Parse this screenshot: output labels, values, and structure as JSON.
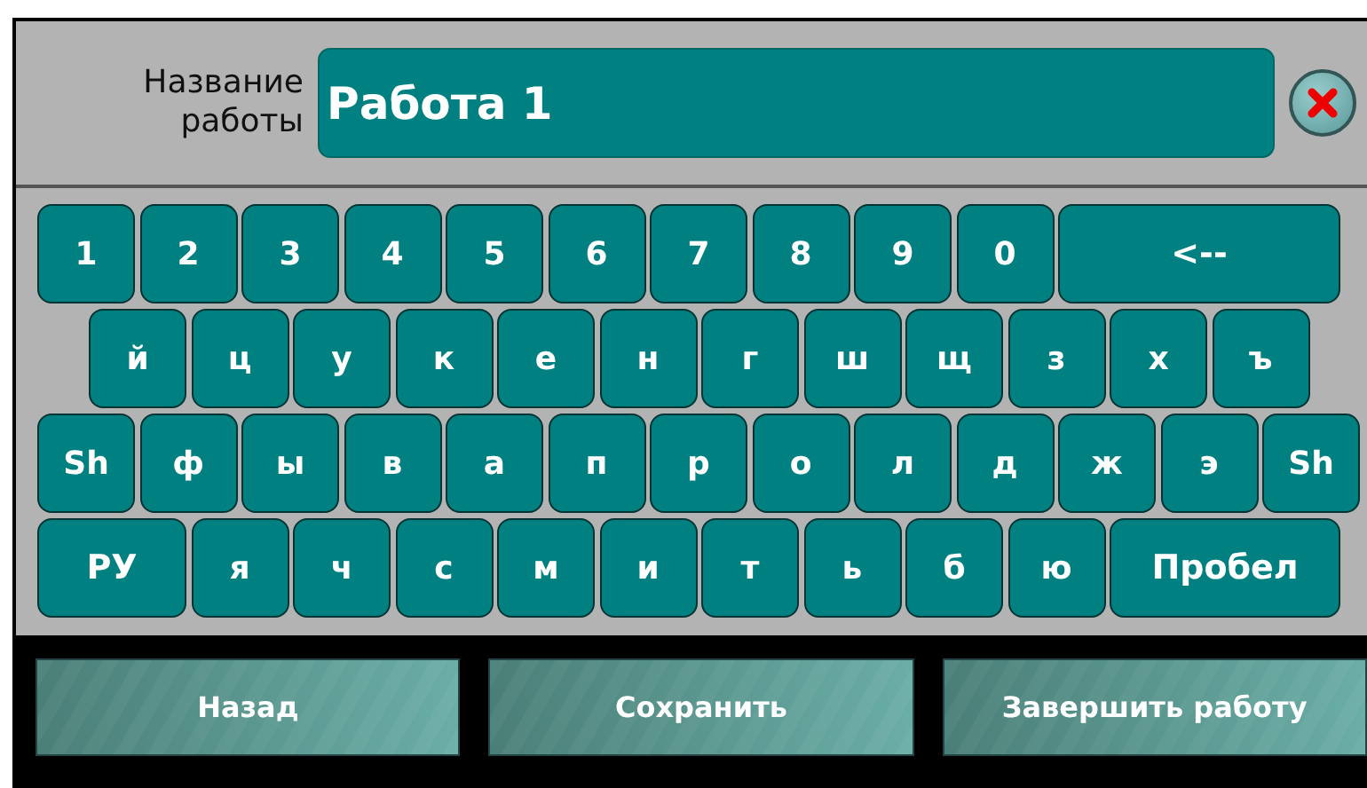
{
  "field": {
    "label": "Название работы",
    "value": "Работа 1"
  },
  "keyboard_rows": [
    [
      {
        "label": "1",
        "kind": "char"
      },
      {
        "label": "2",
        "kind": "char"
      },
      {
        "label": "3",
        "kind": "char"
      },
      {
        "label": "4",
        "kind": "char"
      },
      {
        "label": "5",
        "kind": "char"
      },
      {
        "label": "6",
        "kind": "char"
      },
      {
        "label": "7",
        "kind": "char"
      },
      {
        "label": "8",
        "kind": "char"
      },
      {
        "label": "9",
        "kind": "char"
      },
      {
        "label": "0",
        "kind": "char"
      },
      {
        "label": "<--",
        "kind": "backspace"
      }
    ],
    [
      {
        "label": "й",
        "kind": "char"
      },
      {
        "label": "ц",
        "kind": "char"
      },
      {
        "label": "у",
        "kind": "char"
      },
      {
        "label": "к",
        "kind": "char"
      },
      {
        "label": "е",
        "kind": "char"
      },
      {
        "label": "н",
        "kind": "char"
      },
      {
        "label": "г",
        "kind": "char"
      },
      {
        "label": "ш",
        "kind": "char"
      },
      {
        "label": "щ",
        "kind": "char"
      },
      {
        "label": "з",
        "kind": "char"
      },
      {
        "label": "х",
        "kind": "char"
      },
      {
        "label": "ъ",
        "kind": "char"
      }
    ],
    [
      {
        "label": "Sh",
        "kind": "char"
      },
      {
        "label": "ф",
        "kind": "char"
      },
      {
        "label": "ы",
        "kind": "char"
      },
      {
        "label": "в",
        "kind": "char"
      },
      {
        "label": "а",
        "kind": "char"
      },
      {
        "label": "п",
        "kind": "char"
      },
      {
        "label": "р",
        "kind": "char"
      },
      {
        "label": "о",
        "kind": "char"
      },
      {
        "label": "л",
        "kind": "char"
      },
      {
        "label": "д",
        "kind": "char"
      },
      {
        "label": "ж",
        "kind": "char"
      },
      {
        "label": "э",
        "kind": "char"
      },
      {
        "label": "Sh",
        "kind": "char"
      }
    ],
    [
      {
        "label": "РУ",
        "kind": "layout"
      },
      {
        "label": "я",
        "kind": "char"
      },
      {
        "label": "ч",
        "kind": "char"
      },
      {
        "label": "с",
        "kind": "char"
      },
      {
        "label": "м",
        "kind": "char"
      },
      {
        "label": "и",
        "kind": "char"
      },
      {
        "label": "т",
        "kind": "char"
      },
      {
        "label": "ь",
        "kind": "char"
      },
      {
        "label": "б",
        "kind": "char"
      },
      {
        "label": "ю",
        "kind": "char"
      },
      {
        "label": "Пробел",
        "kind": "space"
      }
    ]
  ],
  "buttons": [
    "Назад",
    "Сохранить",
    "Завершить работу"
  ]
}
